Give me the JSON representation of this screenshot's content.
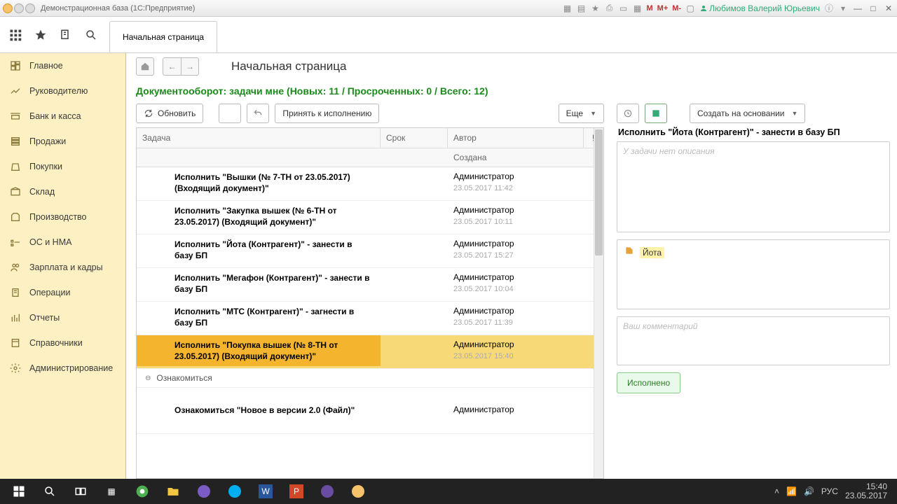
{
  "titlebar": {
    "title": "Демонстрационная база  (1С:Предприятие)",
    "m_labels": [
      "M",
      "M+",
      "M-"
    ],
    "user": "Любимов Валерий Юрьевич"
  },
  "toolstrip": {
    "tab_label": "Начальная страница"
  },
  "sidebar": {
    "items": [
      {
        "label": "Главное"
      },
      {
        "label": "Руководителю"
      },
      {
        "label": "Банк и касса"
      },
      {
        "label": "Продажи"
      },
      {
        "label": "Покупки"
      },
      {
        "label": "Склад"
      },
      {
        "label": "Производство"
      },
      {
        "label": "ОС и НМА"
      },
      {
        "label": "Зарплата и кадры"
      },
      {
        "label": "Операции"
      },
      {
        "label": "Отчеты"
      },
      {
        "label": "Справочники"
      },
      {
        "label": "Администрирование"
      }
    ]
  },
  "page": {
    "title": "Начальная страница",
    "status": "Документооборот: задачи мне (Новых: 11 / Просроченных: 0 / Всего: 12)"
  },
  "actions": {
    "refresh": "Обновить",
    "accept": "Принять к исполнению",
    "more": "Еще"
  },
  "columns": {
    "task": "Задача",
    "due": "Срок",
    "author": "Автор",
    "created": "Создана",
    "flag": "!"
  },
  "tasks": [
    {
      "title": "Исполнить \"Вышки (№ 7-ТН от 23.05.2017) (Входящий документ)\"",
      "author": "Администратор",
      "created": "23.05.2017 11:42"
    },
    {
      "title": "Исполнить \"Закупка вышек (№ 6-ТН от 23.05.2017) (Входящий документ)\"",
      "author": "Администратор",
      "created": "23.05.2017 10:11"
    },
    {
      "title": "Исполнить \"Йота (Контрагент)\" - занести в базу БП",
      "author": "Администратор",
      "created": "23.05.2017 15:27"
    },
    {
      "title": "Исполнить \"Мегафон (Контрагент)\" - занести в базу БП",
      "author": "Администратор",
      "created": "23.05.2017 10:04"
    },
    {
      "title": "Исполнить \"МТС (Контрагент)\" - загнести в базу БП",
      "author": "Администратор",
      "created": "23.05.2017 11:39"
    },
    {
      "title": "Исполнить \"Покупка вышек (№ 8-ТН от 23.05.2017) (Входящий документ)\"",
      "author": "Администратор",
      "created": "23.05.2017 15:40",
      "selected": true
    }
  ],
  "group2": {
    "label": "Ознакомиться"
  },
  "task_extra": {
    "title": "Ознакомиться \"Новое в версии 2.0 (Файл)\"",
    "author": "Администратор"
  },
  "right": {
    "create_based": "Создать на основании",
    "title": "Исполнить \"Йота (Контрагент)\" - занести в базу БП",
    "no_desc": "У задачи нет описания",
    "attachment": "Йота",
    "comment_ph": "Ваш комментарий",
    "done": "Исполнено"
  },
  "tray": {
    "lang": "РУС",
    "time": "15:40",
    "date": "23.05.2017"
  }
}
